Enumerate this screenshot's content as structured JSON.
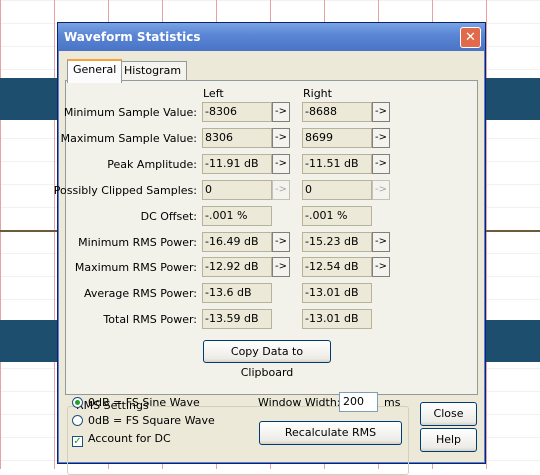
{
  "window": {
    "title": "Waveform Statistics",
    "close_glyph": "✕"
  },
  "tabs": [
    {
      "label": "General",
      "active": true
    },
    {
      "label": "Histogram",
      "active": false
    }
  ],
  "columns": {
    "left": "Left",
    "right": "Right"
  },
  "rows": [
    {
      "label": "Minimum Sample Value:",
      "left": "-8306",
      "right": "-8688",
      "left_button": "active",
      "right_button": "active"
    },
    {
      "label": "Maximum Sample Value:",
      "left": "8306",
      "right": "8699",
      "left_button": "active",
      "right_button": "active"
    },
    {
      "label": "Peak Amplitude:",
      "left": "-11.91 dB",
      "right": "-11.51 dB",
      "left_button": "active",
      "right_button": "active"
    },
    {
      "label": "Possibly Clipped Samples:",
      "left": "0",
      "right": "0",
      "left_button": "disabled",
      "right_button": "disabled"
    },
    {
      "label": "DC Offset:",
      "left": "-.001 %",
      "right": "-.001 %",
      "left_button": "none",
      "right_button": "none"
    },
    {
      "label": "Minimum RMS Power:",
      "left": "-16.49 dB",
      "right": "-15.23 dB",
      "left_button": "active",
      "right_button": "active"
    },
    {
      "label": "Maximum RMS Power:",
      "left": "-12.92 dB",
      "right": "-12.54 dB",
      "left_button": "active",
      "right_button": "active"
    },
    {
      "label": "Average RMS Power:",
      "left": "-13.6 dB",
      "right": "-13.01 dB",
      "left_button": "none",
      "right_button": "none"
    },
    {
      "label": "Total RMS Power:",
      "left": "-13.59 dB",
      "right": "-13.01 dB",
      "left_button": "none",
      "right_button": "none"
    }
  ],
  "arrow_glyph": "->",
  "copy_button": "Copy Data to Clipboard",
  "rms_settings": {
    "title": "RMS Settings",
    "option_sine": "0dB = FS Sine Wave",
    "option_square": "0dB = FS Square Wave",
    "selected": "sine",
    "account_dc": "Account for DC",
    "account_dc_checked": true,
    "window_width_label": "Window Width:",
    "window_width_value": "200",
    "window_width_unit": "ms",
    "recalculate": "Recalculate RMS"
  },
  "buttons": {
    "close": "Close",
    "help": "Help"
  },
  "colors": {
    "waveform": "#1e4e6e",
    "title_bar": "#5b87d5",
    "dialog_bg": "#ece9d8"
  },
  "icons": {
    "close": "close-icon",
    "arrow": "arrow-right-icon",
    "radio_selected": "radio-selected",
    "checkbox_checked": "checkbox-checked"
  }
}
